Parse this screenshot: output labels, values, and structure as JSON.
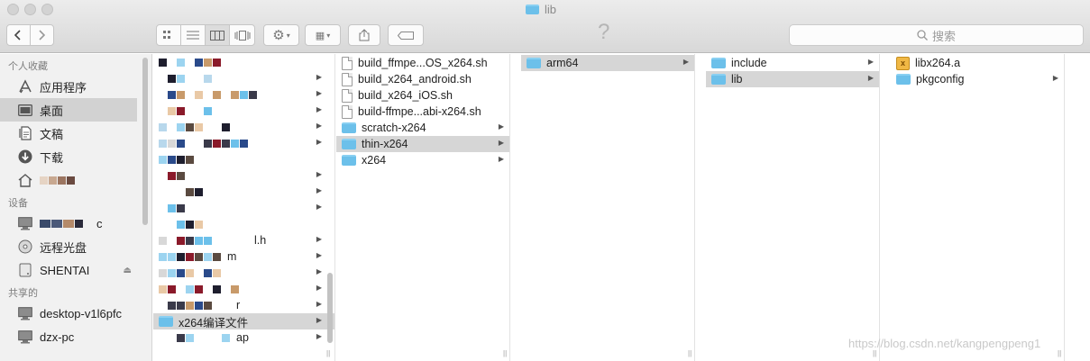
{
  "window": {
    "title": "lib"
  },
  "toolbar": {
    "help_glyph": "?",
    "search_placeholder": "搜索"
  },
  "sidebar": {
    "sections": [
      {
        "header": "个人收藏",
        "items": [
          {
            "label": "应用程序",
            "icon": "applications-icon"
          },
          {
            "label": "桌面",
            "icon": "desktop-icon",
            "selected": true
          },
          {
            "label": "文稿",
            "icon": "documents-icon"
          },
          {
            "label": "下载",
            "icon": "downloads-icon"
          },
          {
            "label": "",
            "icon": "home-icon"
          }
        ]
      },
      {
        "header": "设备",
        "items": [
          {
            "label": "c",
            "icon": "computer-icon"
          },
          {
            "label": "远程光盘",
            "icon": "disc-icon"
          },
          {
            "label": "SHENTAI",
            "icon": "drive-icon"
          }
        ]
      },
      {
        "header": "共享的",
        "items": [
          {
            "label": "desktop-v1l6pfc",
            "icon": "network-computer-icon"
          },
          {
            "label": "dzx-pc",
            "icon": "network-computer-icon"
          }
        ]
      }
    ]
  },
  "column1": {
    "partial_labels": [
      "l.h",
      "m",
      "r",
      "ap"
    ],
    "selected_label": "x264编译文件"
  },
  "column2": {
    "items": [
      {
        "label": "build_ffmpe...OS_x264.sh",
        "type": "doc"
      },
      {
        "label": "build_x264_android.sh",
        "type": "doc"
      },
      {
        "label": "build_x264_iOS.sh",
        "type": "doc"
      },
      {
        "label": "build-ffmpe...abi-x264.sh",
        "type": "doc"
      },
      {
        "label": "scratch-x264",
        "type": "folder"
      },
      {
        "label": "thin-x264",
        "type": "folder",
        "selected": true
      },
      {
        "label": "x264",
        "type": "folder"
      }
    ]
  },
  "column3": {
    "items": [
      {
        "label": "arm64",
        "type": "folder",
        "selected": true
      }
    ]
  },
  "column4": {
    "items": [
      {
        "label": "include",
        "type": "folder"
      },
      {
        "label": "lib",
        "type": "folder",
        "selected": true
      }
    ]
  },
  "column5": {
    "items": [
      {
        "label": "libx264.a",
        "type": "archive"
      },
      {
        "label": "pkgconfig",
        "type": "folder"
      }
    ]
  },
  "watermark": "https://blog.csdn.net/kangpengpeng1",
  "colors": {
    "folder": "#6cc0ea",
    "selection": "#d6d6d6",
    "sidebar_bg": "#f1f1f1"
  }
}
